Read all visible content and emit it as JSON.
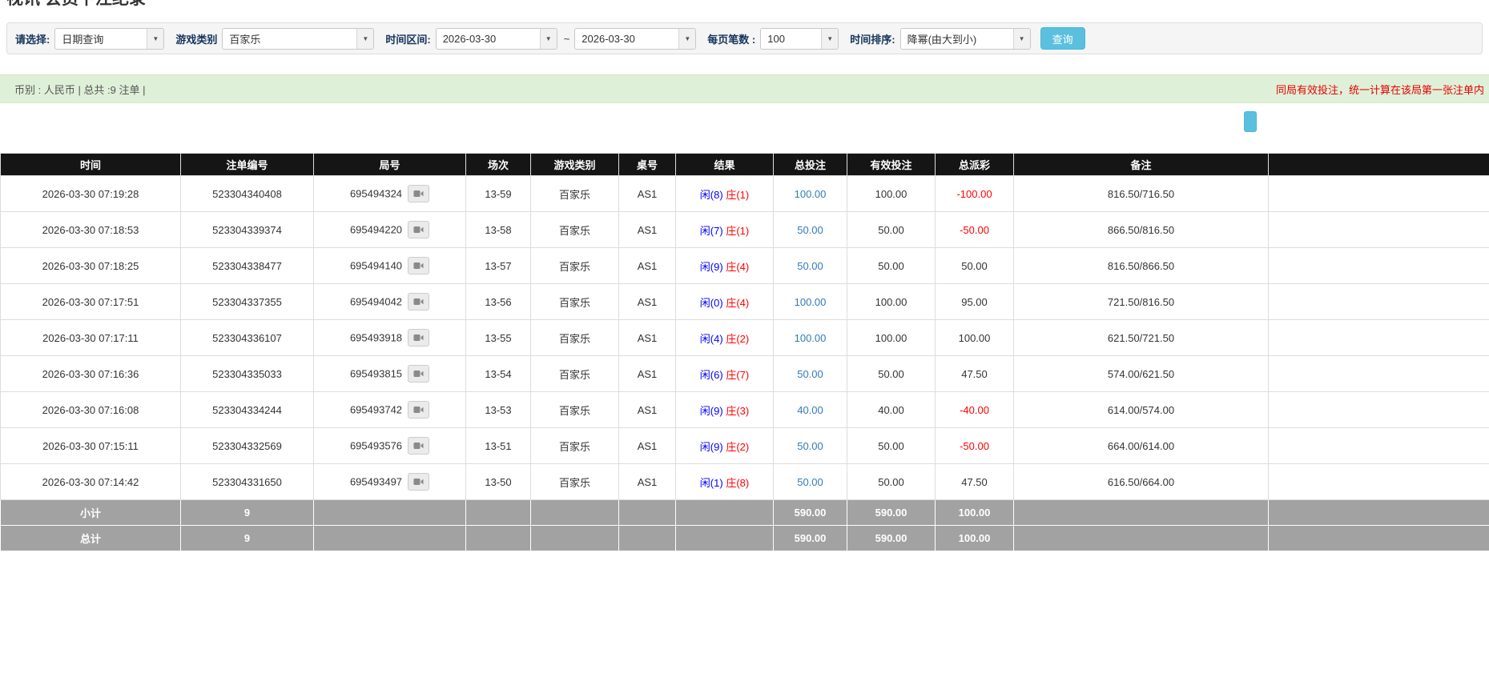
{
  "page": {
    "title": "视讯 会员下注纪录"
  },
  "filter": {
    "select_label": "请选择:",
    "select_value": "日期查询",
    "game_type_label": "游戏类别",
    "game_type_value": "百家乐",
    "time_range_label": "时间区间:",
    "date_from": "2026-03-30",
    "tilde": "~",
    "date_to": "2026-03-30",
    "page_size_label": "每页笔数 :",
    "page_size_value": "100",
    "sort_label": "时间排序:",
    "sort_value": "降幂(由大到小)",
    "query_button": "查询"
  },
  "info_bar": {
    "left": "币别 : 人民币 | 总共 :9 注单 |",
    "right": "同局有效投注，统一计算在该局第一张注单内"
  },
  "icons": {
    "chevron_down": "▼",
    "video": "video-camera"
  },
  "colors": {
    "query_button": "#5bc0de",
    "info_bar_bg": "#dff0d8",
    "notice_red": "#e60000",
    "bet_link_blue": "#337ab7",
    "player_blue": "#0000ff",
    "banker_red": "#ff0000",
    "header_bg": "#151515",
    "footer_bg": "#a2a2a2"
  },
  "table": {
    "headers": [
      "时间",
      "注单编号",
      "局号",
      "场次",
      "游戏类别",
      "桌号",
      "结果",
      "总投注",
      "有效投注",
      "总派彩",
      "备注",
      ""
    ],
    "rows": [
      {
        "time": "2026-03-30 07:19:28",
        "bet_id": "523304340408",
        "round_id": "695494324",
        "session": "13-59",
        "game": "百家乐",
        "table_no": "AS1",
        "result_player": "闲(8)",
        "result_banker": "庄(1)",
        "total_bet": "100.00",
        "valid_bet": "100.00",
        "payout": "-100.00",
        "note": "816.50/716.50"
      },
      {
        "time": "2026-03-30 07:18:53",
        "bet_id": "523304339374",
        "round_id": "695494220",
        "session": "13-58",
        "game": "百家乐",
        "table_no": "AS1",
        "result_player": "闲(7)",
        "result_banker": "庄(1)",
        "total_bet": "50.00",
        "valid_bet": "50.00",
        "payout": "-50.00",
        "note": "866.50/816.50"
      },
      {
        "time": "2026-03-30 07:18:25",
        "bet_id": "523304338477",
        "round_id": "695494140",
        "session": "13-57",
        "game": "百家乐",
        "table_no": "AS1",
        "result_player": "闲(9)",
        "result_banker": "庄(4)",
        "total_bet": "50.00",
        "valid_bet": "50.00",
        "payout": "50.00",
        "note": "816.50/866.50"
      },
      {
        "time": "2026-03-30 07:17:51",
        "bet_id": "523304337355",
        "round_id": "695494042",
        "session": "13-56",
        "game": "百家乐",
        "table_no": "AS1",
        "result_player": "闲(0)",
        "result_banker": "庄(4)",
        "total_bet": "100.00",
        "valid_bet": "100.00",
        "payout": "95.00",
        "note": "721.50/816.50"
      },
      {
        "time": "2026-03-30 07:17:11",
        "bet_id": "523304336107",
        "round_id": "695493918",
        "session": "13-55",
        "game": "百家乐",
        "table_no": "AS1",
        "result_player": "闲(4)",
        "result_banker": "庄(2)",
        "total_bet": "100.00",
        "valid_bet": "100.00",
        "payout": "100.00",
        "note": "621.50/721.50"
      },
      {
        "time": "2026-03-30 07:16:36",
        "bet_id": "523304335033",
        "round_id": "695493815",
        "session": "13-54",
        "game": "百家乐",
        "table_no": "AS1",
        "result_player": "闲(6)",
        "result_banker": "庄(7)",
        "total_bet": "50.00",
        "valid_bet": "50.00",
        "payout": "47.50",
        "note": "574.00/621.50"
      },
      {
        "time": "2026-03-30 07:16:08",
        "bet_id": "523304334244",
        "round_id": "695493742",
        "session": "13-53",
        "game": "百家乐",
        "table_no": "AS1",
        "result_player": "闲(9)",
        "result_banker": "庄(3)",
        "total_bet": "40.00",
        "valid_bet": "40.00",
        "payout": "-40.00",
        "note": "614.00/574.00"
      },
      {
        "time": "2026-03-30 07:15:11",
        "bet_id": "523304332569",
        "round_id": "695493576",
        "session": "13-51",
        "game": "百家乐",
        "table_no": "AS1",
        "result_player": "闲(9)",
        "result_banker": "庄(2)",
        "total_bet": "50.00",
        "valid_bet": "50.00",
        "payout": "-50.00",
        "note": "664.00/614.00"
      },
      {
        "time": "2026-03-30 07:14:42",
        "bet_id": "523304331650",
        "round_id": "695493497",
        "session": "13-50",
        "game": "百家乐",
        "table_no": "AS1",
        "result_player": "闲(1)",
        "result_banker": "庄(8)",
        "total_bet": "50.00",
        "valid_bet": "50.00",
        "payout": "47.50",
        "note": "616.50/664.00"
      }
    ],
    "subtotal": {
      "label": "小计",
      "count": "9",
      "total_bet": "590.00",
      "valid_bet": "590.00",
      "payout": "100.00"
    },
    "total": {
      "label": "总计",
      "count": "9",
      "total_bet": "590.00",
      "valid_bet": "590.00",
      "payout": "100.00"
    }
  }
}
